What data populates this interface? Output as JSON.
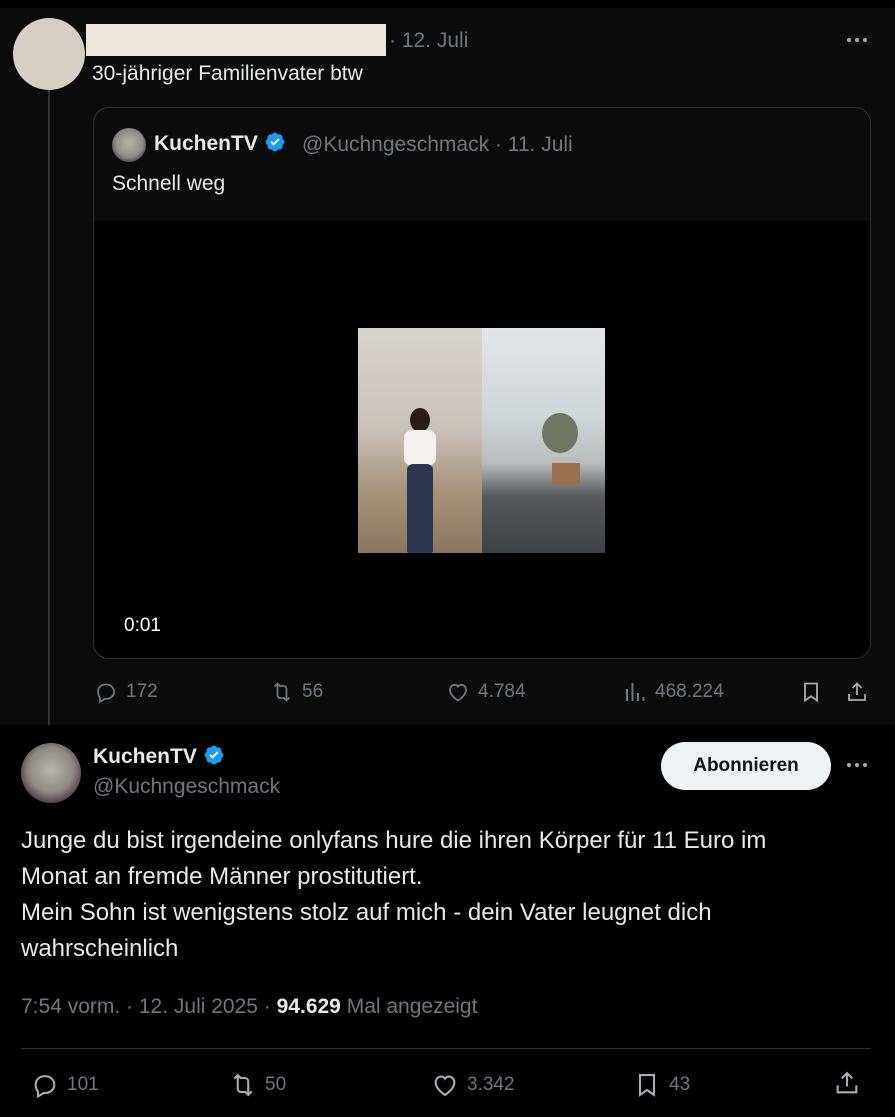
{
  "first_post": {
    "date": "· 12. Juli",
    "text": "30-jähriger Familienvater btw"
  },
  "quoted_post": {
    "author_name": "KuchenTV",
    "handle_date": "@Kuchngeschmack · 11. Juli",
    "text": "Schnell weg",
    "video_time": "0:01"
  },
  "first_post_actions": {
    "replies": "172",
    "reposts": "56",
    "likes": "4.784",
    "views": "468.224"
  },
  "main_post": {
    "author_name": "KuchenTV",
    "handle": "@Kuchngeschmack",
    "subscribe_label": "Abonnieren",
    "text_lines": [
      "Junge du bist irgendeine onlyfans hure die ihren Körper für 11 Euro im",
      "Monat an fremde Männer prostitutiert.",
      "Mein Sohn ist wenigstens stolz auf mich - dein Vater leugnet dich",
      "wahrscheinlich"
    ],
    "time_date": "7:54 vorm. · 12. Juli 2025 · ",
    "views_count": "94.629",
    "views_label": "Mal angezeigt"
  },
  "main_post_actions": {
    "replies": "101",
    "reposts": "50",
    "likes": "3.342",
    "bookmarks": "43"
  },
  "colors": {
    "verified": "#1d9bf0",
    "muted_text": "#71767b",
    "primary_text": "#e7e9ea"
  },
  "icons": [
    "more-icon",
    "verified-badge-icon",
    "reply-icon",
    "repost-icon",
    "like-icon",
    "views-icon",
    "bookmark-icon",
    "share-icon"
  ]
}
